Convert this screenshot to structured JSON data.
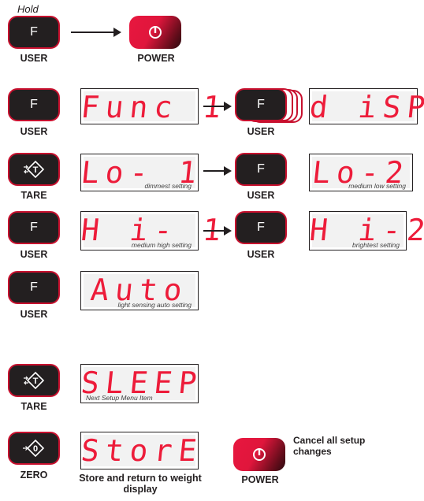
{
  "hold_label": "Hold",
  "keys": {
    "f": "F",
    "user": "USER",
    "tare": "TARE",
    "zero": "ZERO",
    "power": "POWER"
  },
  "displays": {
    "func1": "Func 1",
    "displ": "d iSPL",
    "lo1": "Lo- 1",
    "lo2": "Lo-2",
    "hi1": "H i- 1",
    "hi2": "H i-2",
    "auto": "Auto",
    "sleep": "SLEEP",
    "store": "StorE"
  },
  "captions": {
    "lo1": "dimmest setting",
    "lo2": "medium low setting",
    "hi1": "medium high setting",
    "hi2": "brightest setting",
    "auto": "light sensing auto setting",
    "sleep": "Next Setup Menu Item"
  },
  "notes": {
    "store": "Store and return to weight display",
    "cancel": "Cancel all setup changes"
  },
  "icons": {
    "power": "power-icon",
    "tare": "tare-icon",
    "zero": "zero-icon",
    "arrow": "arrow-right-icon"
  },
  "colors": {
    "segment": "#ed1c3a",
    "key_border": "#c8102e",
    "key_fill": "#231f20"
  }
}
